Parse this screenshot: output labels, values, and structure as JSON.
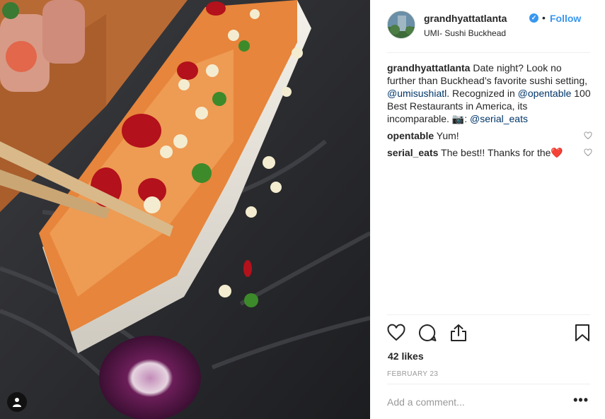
{
  "post": {
    "username": "grandhyattatlanta",
    "verified_icon": "verified-badge-icon",
    "separator": "•",
    "follow_label": "Follow",
    "location": "UMI- Sushi Buckhead"
  },
  "caption": {
    "username": "grandhyattatlanta",
    "text_1": "Date night? Look no further than Buckhead’s favorite sushi setting,",
    "mention_1": "@umisushiatl",
    "text_2": ". Recognized in",
    "mention_2": "@opentable",
    "text_3": "100 Best Restaurants in America, its incomparable. 📷:",
    "mention_3": "@serial_eats"
  },
  "comments": [
    {
      "username": "opentable",
      "text": "Yum!"
    },
    {
      "username": "serial_eats",
      "text": "The best!! Thanks for the❤️"
    }
  ],
  "likes": "42 likes",
  "date": "FEBRUARY 23",
  "add_comment": {
    "placeholder": "Add a comment..."
  },
  "more_label": "•••",
  "colors": {
    "accent": "#3897f0",
    "mention": "#003569",
    "divider": "#efefef"
  }
}
